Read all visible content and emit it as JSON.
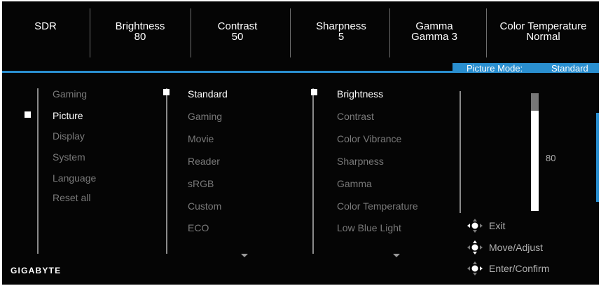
{
  "status_bar": [
    {
      "label": "SDR",
      "value": ""
    },
    {
      "label": "Brightness",
      "value": "80"
    },
    {
      "label": "Contrast",
      "value": "50"
    },
    {
      "label": "Sharpness",
      "value": "5"
    },
    {
      "label": "Gamma",
      "value": "Gamma 3"
    },
    {
      "label": "Color Temperature",
      "value": "Normal"
    }
  ],
  "mode_indicator": {
    "label": "Picture Mode:",
    "value": "Standard"
  },
  "main_menu": [
    "Gaming",
    "Picture",
    "Display",
    "System",
    "Language",
    "Reset all"
  ],
  "picture_modes": [
    "Standard",
    "Gaming",
    "Movie",
    "Reader",
    "sRGB",
    "Custom",
    "ECO"
  ],
  "settings": [
    "Brightness",
    "Contrast",
    "Color Vibrance",
    "Sharpness",
    "Gamma",
    "Color Temperature",
    "Low Blue Light"
  ],
  "slider": {
    "value": "80",
    "level_fraction": 0.8
  },
  "hints": [
    {
      "label": "Exit",
      "icon": "joystick-left-icon"
    },
    {
      "label": "Move/Adjust",
      "icon": "joystick-updown-icon"
    },
    {
      "label": "Enter/Confirm",
      "icon": "joystick-press-icon"
    }
  ],
  "brand": "GIGABYTE",
  "colors": {
    "accent": "#2a8fd0",
    "background": "#050505",
    "active_text": "#ffffff",
    "inactive_text": "#7a7a7a"
  }
}
